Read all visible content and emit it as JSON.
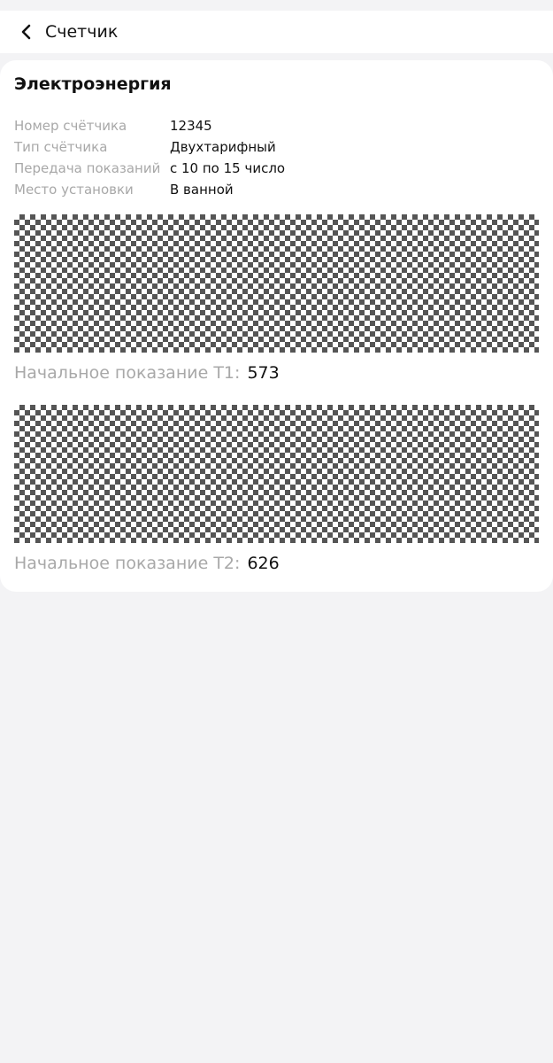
{
  "header": {
    "back_icon": "chevron-left-icon",
    "title": "Счетчик"
  },
  "meter": {
    "title": "Электроэнергия",
    "details": [
      {
        "label": "Номер счётчика",
        "value": "12345"
      },
      {
        "label": "Тип счётчика",
        "value": "Двухтарифный"
      },
      {
        "label": "Передача показаний",
        "value": "с 10 по 15 число"
      },
      {
        "label": "Место установки",
        "value": "В ванной"
      }
    ],
    "readings": [
      {
        "label": "Начальное показание Т1:",
        "value": "573"
      },
      {
        "label": "Начальное показание Т2:",
        "value": "626"
      }
    ]
  },
  "colors": {
    "background": "#f3f3f5",
    "card": "#ffffff",
    "label_gray": "#a8a8a8",
    "text": "#111111"
  }
}
